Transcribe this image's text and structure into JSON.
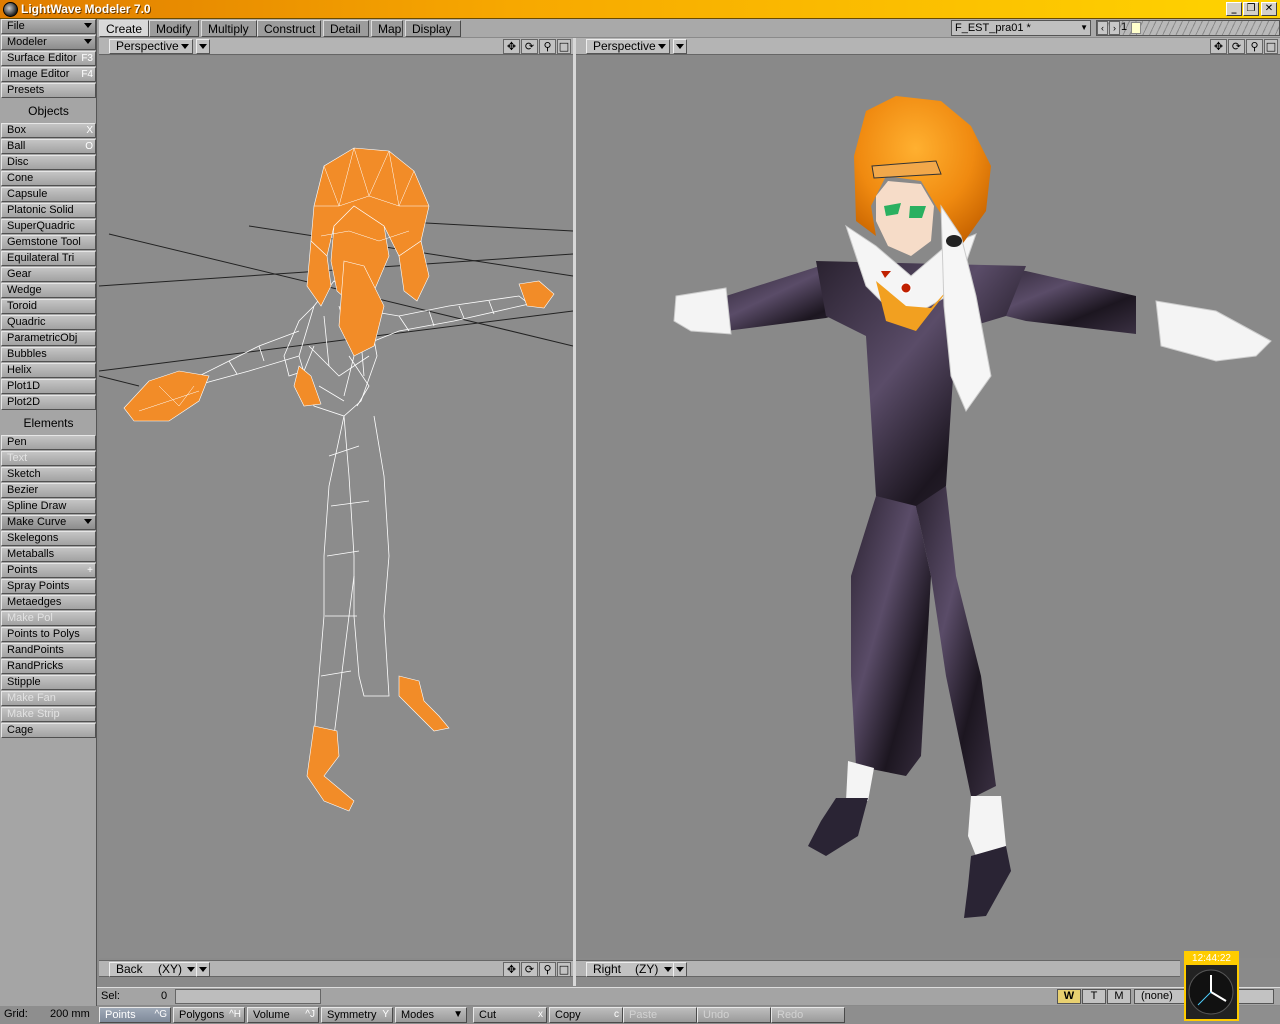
{
  "window": {
    "title": "LightWave Modeler 7.0",
    "minimize": "_",
    "maximize": "❐",
    "close": "✕"
  },
  "tabs": [
    "Create",
    "Modify",
    "Multiply",
    "Construct",
    "Detail",
    "Map",
    "Display"
  ],
  "active_tab": "Create",
  "file": {
    "name": "F_EST_pra01 *",
    "layer": "1"
  },
  "sidebar": {
    "top": [
      {
        "label": "File",
        "key": ""
      },
      {
        "label": "Modeler",
        "key": ""
      },
      {
        "label": "Surface Editor",
        "key": "F3"
      },
      {
        "label": "Image Editor",
        "key": "F4"
      },
      {
        "label": "Presets",
        "key": ""
      }
    ],
    "objects_header": "Objects",
    "objects": [
      {
        "label": "Box",
        "key": "X"
      },
      {
        "label": "Ball",
        "key": "O"
      },
      {
        "label": "Disc",
        "key": ""
      },
      {
        "label": "Cone",
        "key": ""
      },
      {
        "label": "Capsule",
        "key": ""
      },
      {
        "label": "Platonic Solid",
        "key": ""
      },
      {
        "label": "SuperQuadric",
        "key": ""
      },
      {
        "label": "Gemstone Tool",
        "key": ""
      },
      {
        "label": "Equilateral Tri",
        "key": ""
      },
      {
        "label": "Gear",
        "key": ""
      },
      {
        "label": "Wedge",
        "key": ""
      },
      {
        "label": "Toroid",
        "key": ""
      },
      {
        "label": "Quadric",
        "key": ""
      },
      {
        "label": "ParametricObj",
        "key": ""
      },
      {
        "label": "Bubbles",
        "key": ""
      },
      {
        "label": "Helix",
        "key": ""
      },
      {
        "label": "Plot1D",
        "key": ""
      },
      {
        "label": "Plot2D",
        "key": ""
      }
    ],
    "elements_header": "Elements",
    "elements": [
      {
        "label": "Pen",
        "key": ""
      },
      {
        "label": "Text",
        "key": "",
        "disabled": true
      },
      {
        "label": "Sketch",
        "key": "`"
      },
      {
        "label": "Bezier",
        "key": ""
      },
      {
        "label": "Spline Draw",
        "key": ""
      },
      {
        "label": "Make Curve",
        "key": "",
        "dropdown": true
      },
      {
        "label": "Skelegons",
        "key": ""
      },
      {
        "label": "Metaballs",
        "key": ""
      },
      {
        "label": "Points",
        "key": "+"
      },
      {
        "label": "Spray Points",
        "key": ""
      },
      {
        "label": "Metaedges",
        "key": ""
      },
      {
        "label": "Make Pol",
        "key": "",
        "disabled": true
      },
      {
        "label": "Points to Polys",
        "key": ""
      },
      {
        "label": "RandPoints",
        "key": ""
      },
      {
        "label": "RandPricks",
        "key": ""
      },
      {
        "label": "Stipple",
        "key": ""
      },
      {
        "label": "Make Fan",
        "key": "",
        "disabled": true
      },
      {
        "label": "Make Strip",
        "key": "",
        "disabled": true
      },
      {
        "label": "Cage",
        "key": ""
      }
    ]
  },
  "viewports": {
    "top_left": {
      "view": "Perspective"
    },
    "top_right": {
      "view": "Perspective"
    },
    "bottom_left": {
      "view": "Back",
      "axis": "(XY)"
    },
    "bottom_right": {
      "view": "Right",
      "axis": "(ZY)"
    }
  },
  "status": {
    "sel_label": "Sel:",
    "sel_value": "0",
    "w": "W",
    "t": "T",
    "m": "M",
    "surface": "(none)"
  },
  "grid": {
    "label": "Grid:",
    "value": "200 mm"
  },
  "bottom_buttons": [
    {
      "label": "Points",
      "key": "^G",
      "active": true
    },
    {
      "label": "Polygons",
      "key": "^H"
    },
    {
      "label": "Volume",
      "key": "^J"
    },
    {
      "label": "Symmetry",
      "key": "Y"
    },
    {
      "label": "Modes",
      "key": ""
    },
    {
      "label": "Cut",
      "key": "x"
    },
    {
      "label": "Copy",
      "key": "c"
    },
    {
      "label": "Paste",
      "key": "",
      "disabled": true
    },
    {
      "label": "Undo",
      "key": "",
      "disabled": true
    },
    {
      "label": "Redo",
      "key": "",
      "disabled": true
    }
  ],
  "clock": {
    "time": "12:44:22"
  },
  "colors": {
    "mesh_orange": "#f28c28",
    "viewport_bg": "#8c8c8c",
    "title_gradient": "#f7a800"
  }
}
